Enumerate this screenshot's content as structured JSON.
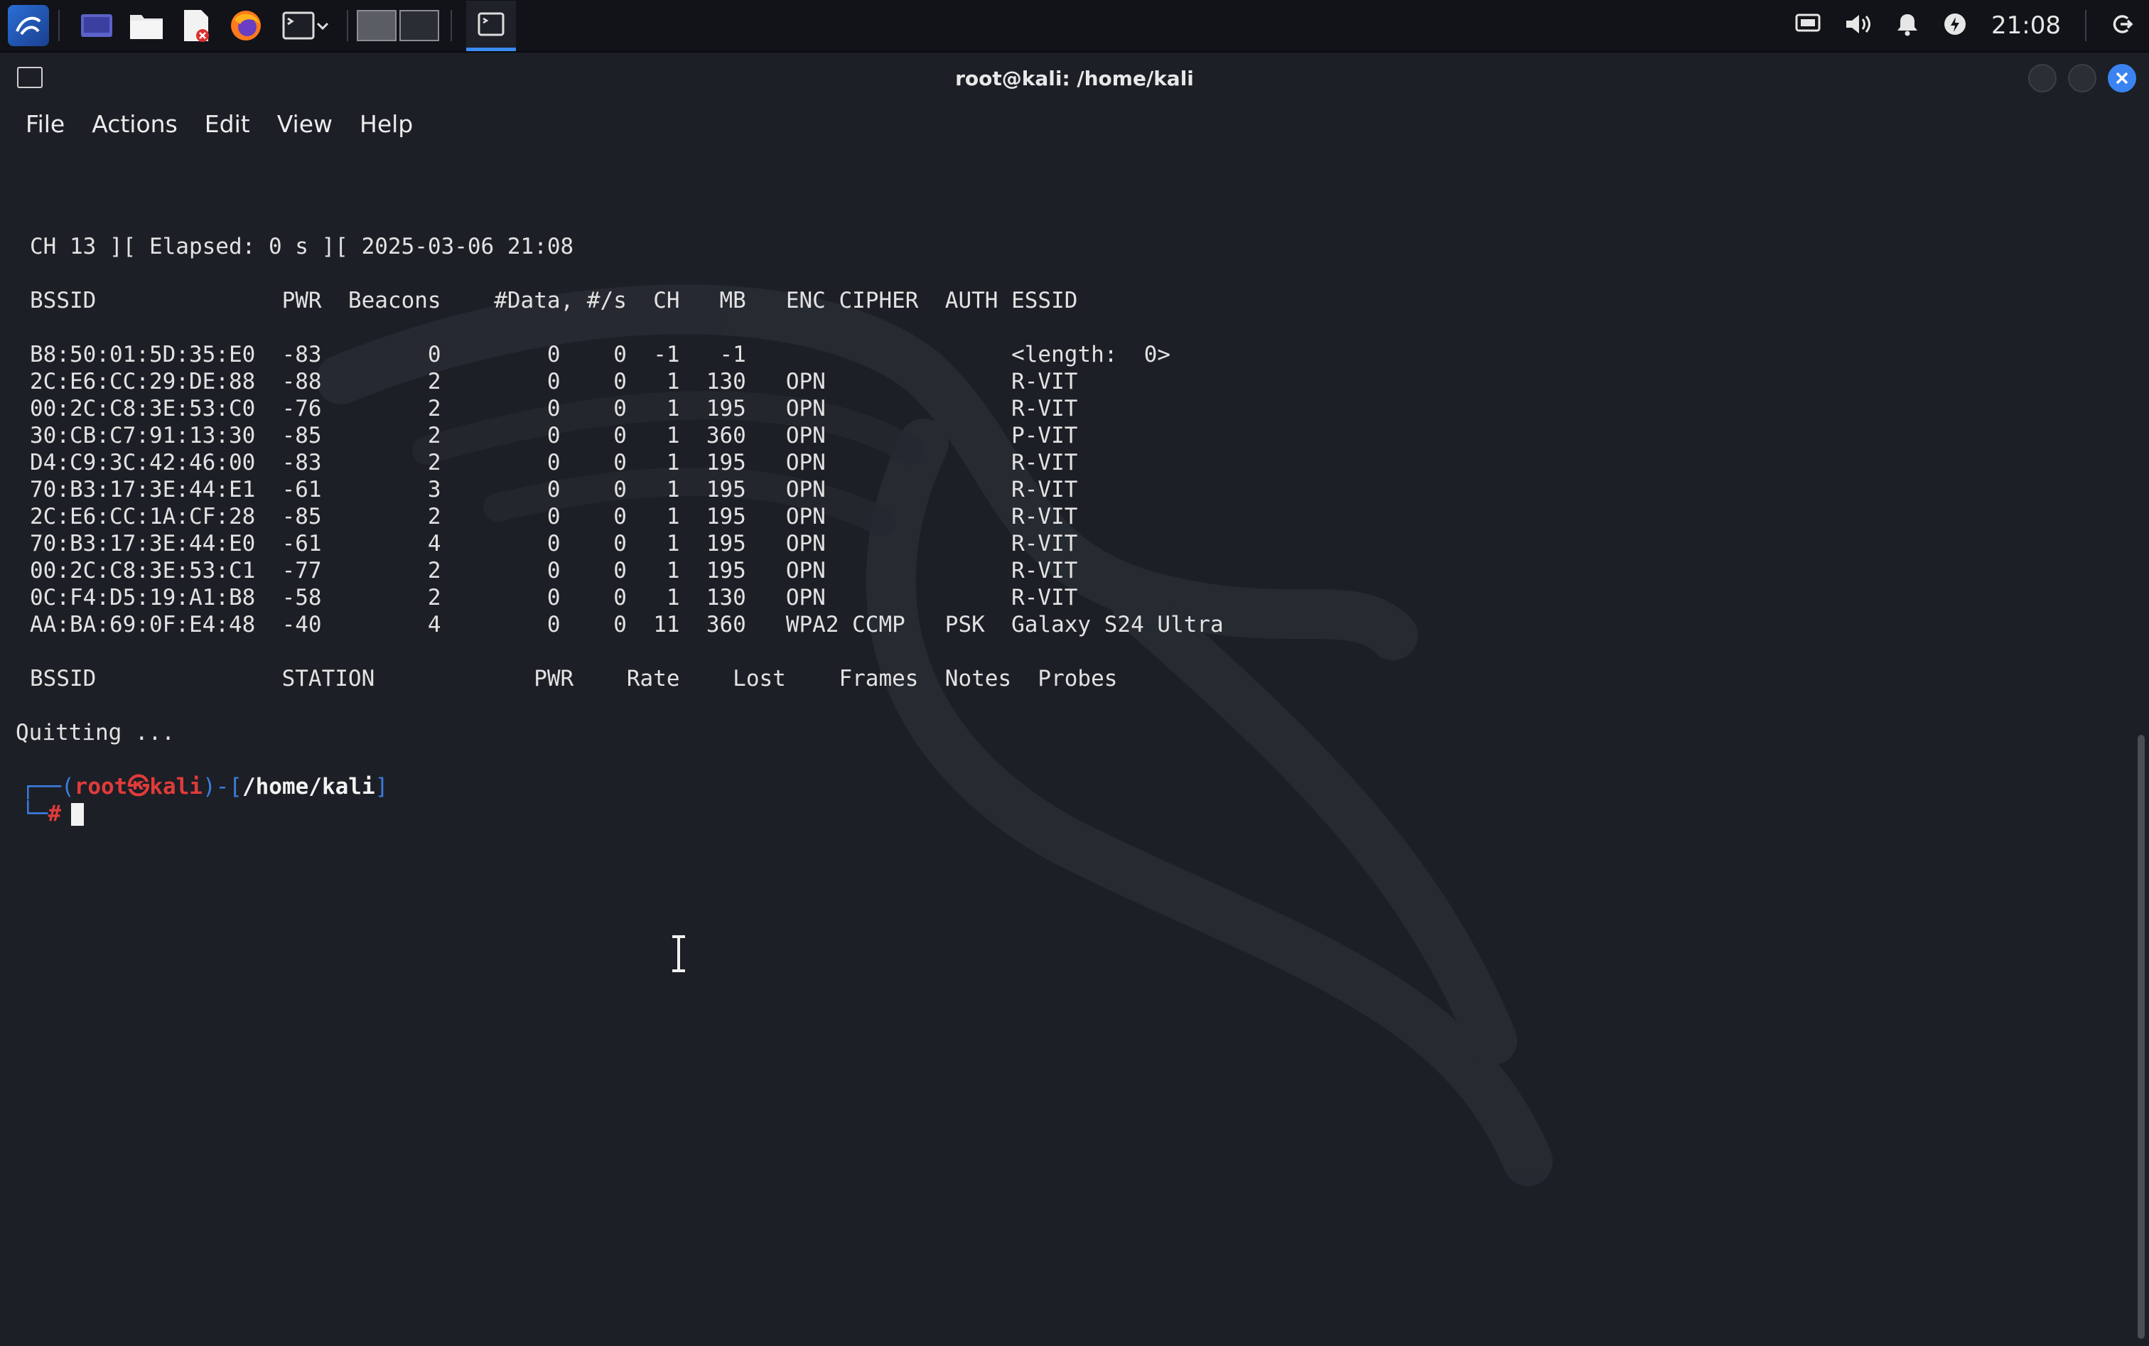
{
  "taskbar": {
    "icons": [
      "kali-menu-icon",
      "desktop-icon",
      "file-manager-icon",
      "text-editor-icon",
      "firefox-icon",
      "terminal-icon"
    ],
    "clock": "21:08"
  },
  "window": {
    "title": "root@kali: /home/kali",
    "menu": [
      "File",
      "Actions",
      "Edit",
      "View",
      "Help"
    ]
  },
  "terminal": {
    "status_line": "CH 13 ][ Elapsed: 0 s ][ 2025-03-06 21:08",
    "ap_header": "BSSID              PWR  Beacons    #Data, #/s  CH   MB   ENC CIPHER  AUTH ESSID",
    "ap_rows": [
      "B8:50:01:5D:35:E0  -83        0        0    0  -1   -1                    <length:  0>",
      "2C:E6:CC:29:DE:88  -88        2        0    0   1  130   OPN              R-VIT",
      "00:2C:C8:3E:53:C0  -76        2        0    0   1  195   OPN              R-VIT",
      "30:CB:C7:91:13:30  -85        2        0    0   1  360   OPN              P-VIT",
      "D4:C9:3C:42:46:00  -83        2        0    0   1  195   OPN              R-VIT",
      "70:B3:17:3E:44:E1  -61        3        0    0   1  195   OPN              R-VIT",
      "2C:E6:CC:1A:CF:28  -85        2        0    0   1  195   OPN              R-VIT",
      "70:B3:17:3E:44:E0  -61        4        0    0   1  195   OPN              R-VIT",
      "00:2C:C8:3E:53:C1  -77        2        0    0   1  195   OPN              R-VIT",
      "0C:F4:D5:19:A1:B8  -58        2        0    0   1  130   OPN              R-VIT",
      "AA:BA:69:0F:E4:48  -40        4        0    0  11  360   WPA2 CCMP   PSK  Galaxy S24 Ultra"
    ],
    "station_header": "BSSID              STATION            PWR    Rate    Lost    Frames  Notes  Probes",
    "quitting": "Quitting ...",
    "prompt": {
      "open": "┌──(",
      "user": "root",
      "at": "㉿",
      "host": "kali",
      "mid": ")-[",
      "path": "/home/kali",
      "close": "]",
      "second_line": "└─",
      "hash": "#"
    }
  }
}
